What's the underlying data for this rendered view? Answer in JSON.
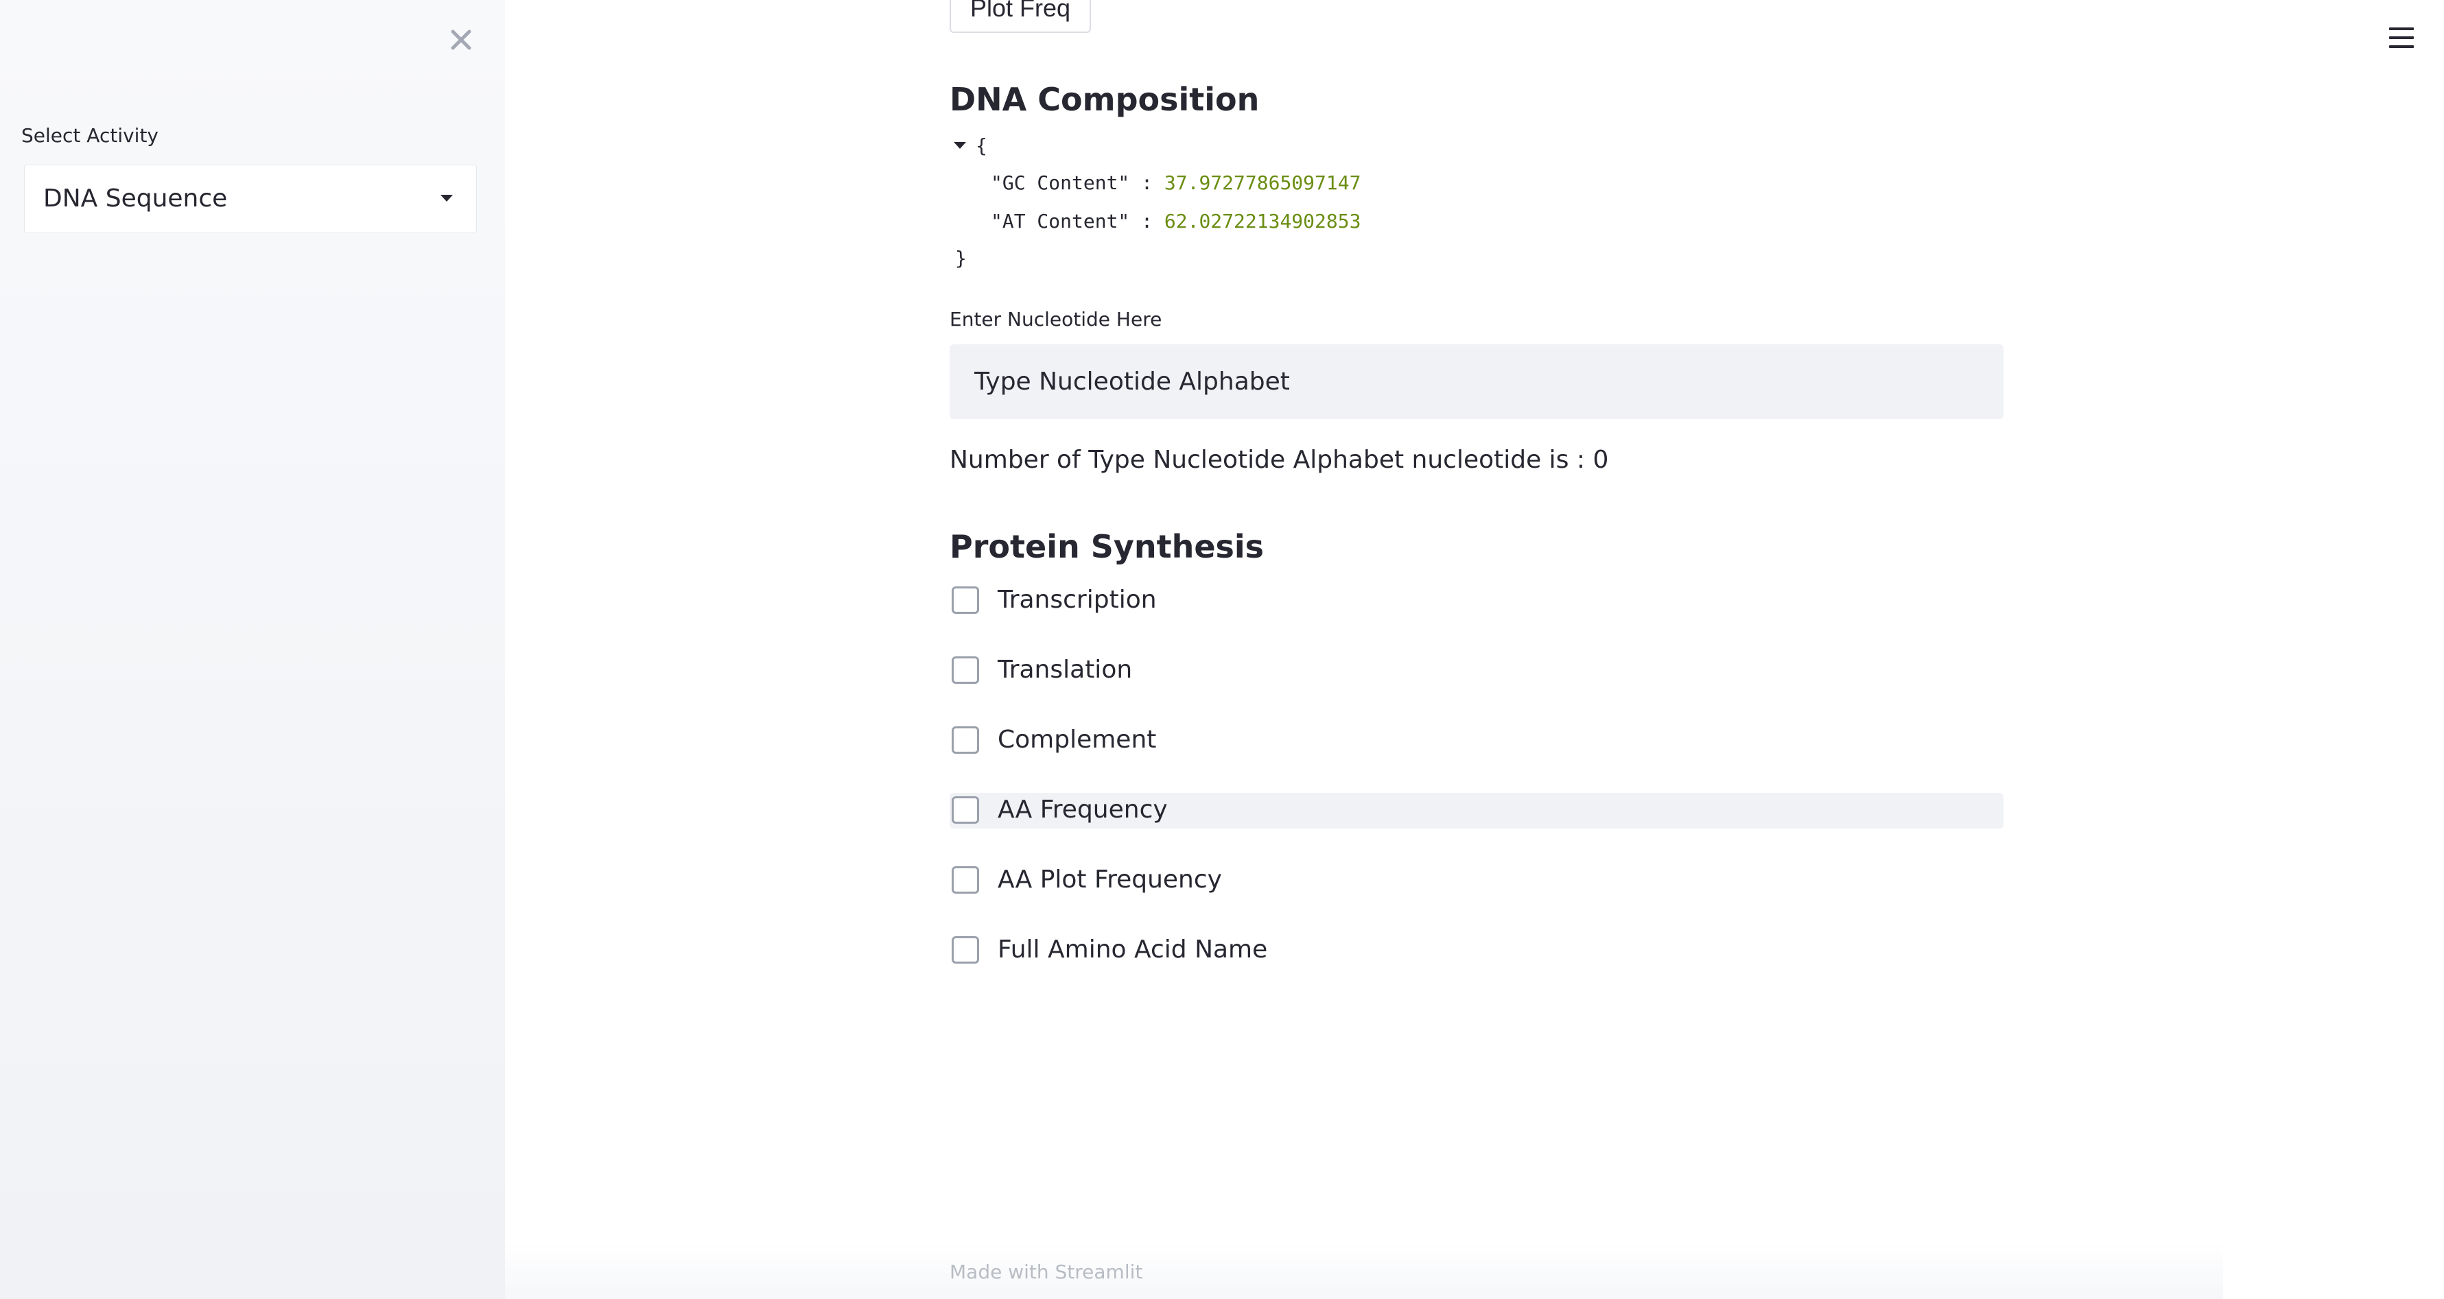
{
  "sidebar": {
    "select_label": "Select Activity",
    "select_value": "DNA Sequence"
  },
  "main": {
    "plot_button_label": "Plot Freq",
    "dna_composition": {
      "heading": "DNA Composition",
      "open_brace": "{",
      "close_brace": "}",
      "rows": [
        {
          "key": "\"GC Content\"",
          "sep": " : ",
          "value": "37.97277865097147"
        },
        {
          "key": "\"AT Content\"",
          "sep": " : ",
          "value": "62.02722134902853"
        }
      ]
    },
    "nucleotide_input": {
      "label": "Enter Nucleotide Here",
      "value": "Type Nucleotide Alphabet"
    },
    "count_text": "Number of Type Nucleotide Alphabet nucleotide is : 0",
    "protein_synthesis": {
      "heading": "Protein Synthesis",
      "options": [
        {
          "label": "Transcription",
          "checked": false
        },
        {
          "label": "Translation",
          "checked": false
        },
        {
          "label": "Complement",
          "checked": false
        },
        {
          "label": "AA Frequency",
          "checked": false
        },
        {
          "label": "AA Plot Frequency",
          "checked": false
        },
        {
          "label": "Full Amino Acid Name",
          "checked": false
        }
      ]
    }
  },
  "footer": {
    "text": "Made with Streamlit"
  },
  "colors": {
    "sidebar_bg": "#f0f2f6",
    "input_bg": "#f0f2f6",
    "json_value": "#6a8d12",
    "text": "#262730"
  },
  "icons": {
    "sidebar_close": "close-icon",
    "menu": "hamburger-menu-icon",
    "select_caret": "caret-down-icon",
    "json_toggle": "triangle-down-icon"
  }
}
